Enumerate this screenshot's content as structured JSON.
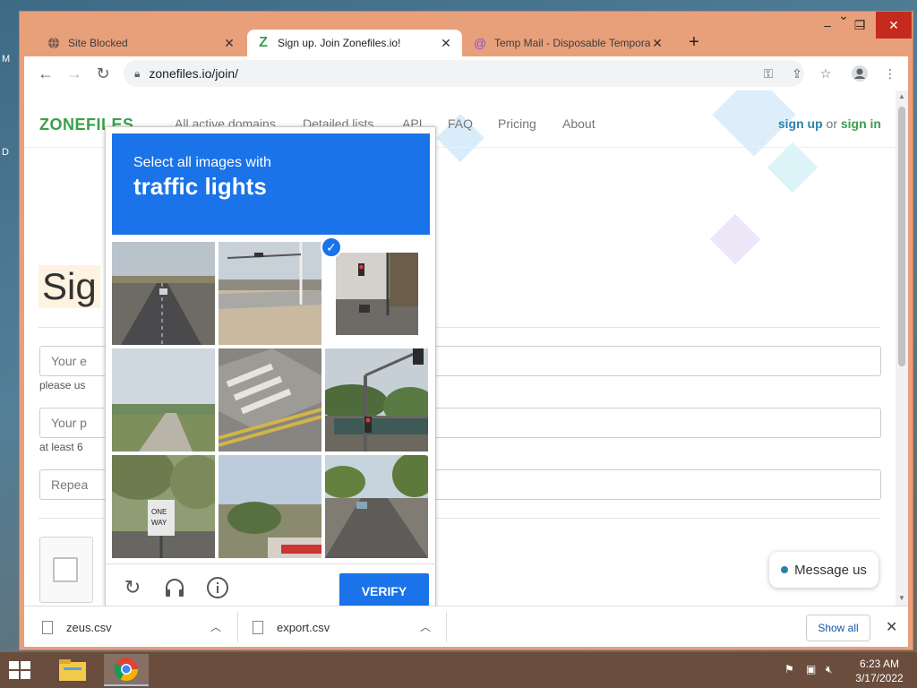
{
  "browser": {
    "tabs": [
      {
        "label": "Site Blocked",
        "favicon": "globe-icon",
        "active": false
      },
      {
        "label": "Sign up. Join Zonefiles.io!",
        "favicon": "zonefiles-icon",
        "active": true
      },
      {
        "label": "Temp Mail - Disposable Tempora",
        "favicon": "at-icon",
        "active": false
      }
    ],
    "url": "zonefiles.io/join/"
  },
  "site": {
    "logo": "ZONEFILES",
    "nav": [
      "All active domains",
      "Detailed lists",
      "API",
      "FAQ",
      "Pricing",
      "About"
    ],
    "signup": "sign up",
    "or": "or",
    "signin": "sign in",
    "page_title": "Sig",
    "email_placeholder": "Your e",
    "email_hint": "please us",
    "password_placeholder": "Your p",
    "password_hint": "at least 6",
    "repeat_placeholder": "Repea",
    "message_us": "Message us"
  },
  "captcha": {
    "instruction": "Select all images with",
    "target": "traffic lights",
    "verify_label": "VERIFY",
    "tiles": [
      {
        "name": "tile-road-car",
        "selected": false
      },
      {
        "name": "tile-intersection",
        "selected": false
      },
      {
        "name": "tile-traffic-light-street",
        "selected": true
      },
      {
        "name": "tile-rural-road",
        "selected": false
      },
      {
        "name": "tile-crosswalk",
        "selected": false
      },
      {
        "name": "tile-traffic-light-pole",
        "selected": false
      },
      {
        "name": "tile-one-way-sign",
        "selected": false
      },
      {
        "name": "tile-hillside-town",
        "selected": false
      },
      {
        "name": "tile-residential-street",
        "selected": false
      }
    ]
  },
  "downloads": {
    "items": [
      {
        "name": "zeus.csv"
      },
      {
        "name": "export.csv"
      }
    ],
    "show_all": "Show all"
  },
  "taskbar": {
    "time": "6:23 AM",
    "date": "3/17/2022"
  },
  "colors": {
    "accent": "#1a73e8",
    "logo_green": "#3aa04a",
    "window_frame": "#e8a07a"
  }
}
